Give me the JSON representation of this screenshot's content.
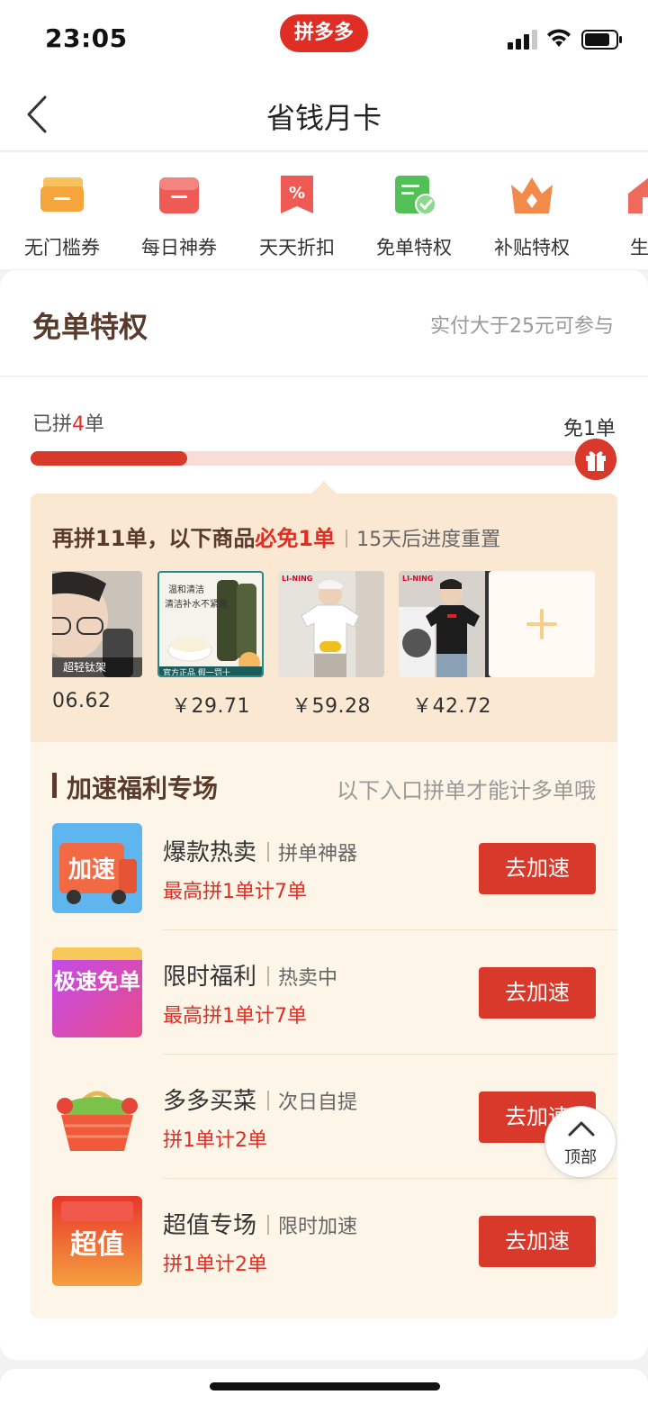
{
  "status_bar": {
    "time": "23:05",
    "logo_text": "拼多多"
  },
  "nav": {
    "title": "省钱月卡"
  },
  "categories": [
    {
      "label": "无门槛券",
      "icon": "coupon-stack-icon",
      "color": "#f5a53c"
    },
    {
      "label": "每日神券",
      "icon": "red-coupon-icon",
      "color": "#ef5a55"
    },
    {
      "label": "天天折扣",
      "icon": "discount-tag-icon",
      "color": "#ef5a55"
    },
    {
      "label": "免单特权",
      "icon": "free-order-check-icon",
      "color": "#52c057"
    },
    {
      "label": "补贴特权",
      "icon": "crown-icon",
      "color": "#f28a4a"
    },
    {
      "label": "生活",
      "icon": "home-icon",
      "color": "#ef6a5a"
    }
  ],
  "card": {
    "title": "免单特权",
    "note": "实付大于25元可参与",
    "progress": {
      "prefix": "已拼",
      "count": "4",
      "suffix": "单",
      "goal_label": "免1单",
      "fraction": 0.28
    },
    "goods": {
      "headline_prefix": "再拼11单，以下商品",
      "headline_highlight": "必免1单",
      "reset_note": "15天后进度重置",
      "items": [
        {
          "price": "06.62",
          "badge": "超轻钛架",
          "icon": "glasses-man-photo"
        },
        {
          "price": "￥29.71",
          "badge": "官方正品 假一罚十",
          "icon": "cleanser-photo",
          "caption_top": "温和清洁",
          "caption_mid": "清洁补水不紧绷"
        },
        {
          "price": "￥59.28",
          "badge": "LI-NING",
          "icon": "white-tshirt-photo"
        },
        {
          "price": "￥42.72",
          "badge": "LI-NING",
          "icon": "black-tshirt-photo"
        }
      ]
    },
    "speed": {
      "title": "加速福利专场",
      "note": "以下入口拼单才能计多单哦",
      "rows": [
        {
          "name": "爆款热卖",
          "tag": "拼单神器",
          "desc": "最高拼1单计7单",
          "button": "去加速",
          "image_text": "加速"
        },
        {
          "name": "限时福利",
          "tag": "热卖中",
          "desc": "最高拼1单计7单",
          "button": "去加速",
          "image_text": "极速免单"
        },
        {
          "name": "多多买菜",
          "tag": "次日自提",
          "desc": "拼1单计2单",
          "button": "去加速",
          "image_text": ""
        },
        {
          "name": "超值专场",
          "tag": "限时加速",
          "desc": "拼1单计2单",
          "button": "去加速",
          "image_text": "超值"
        }
      ]
    }
  },
  "back_to_top": {
    "label": "顶部"
  },
  "colors": {
    "brand_red": "#e02e24",
    "button_red": "#d8392b",
    "panel_beige": "#fbe8d2",
    "section_cream": "#fdf5e8"
  }
}
